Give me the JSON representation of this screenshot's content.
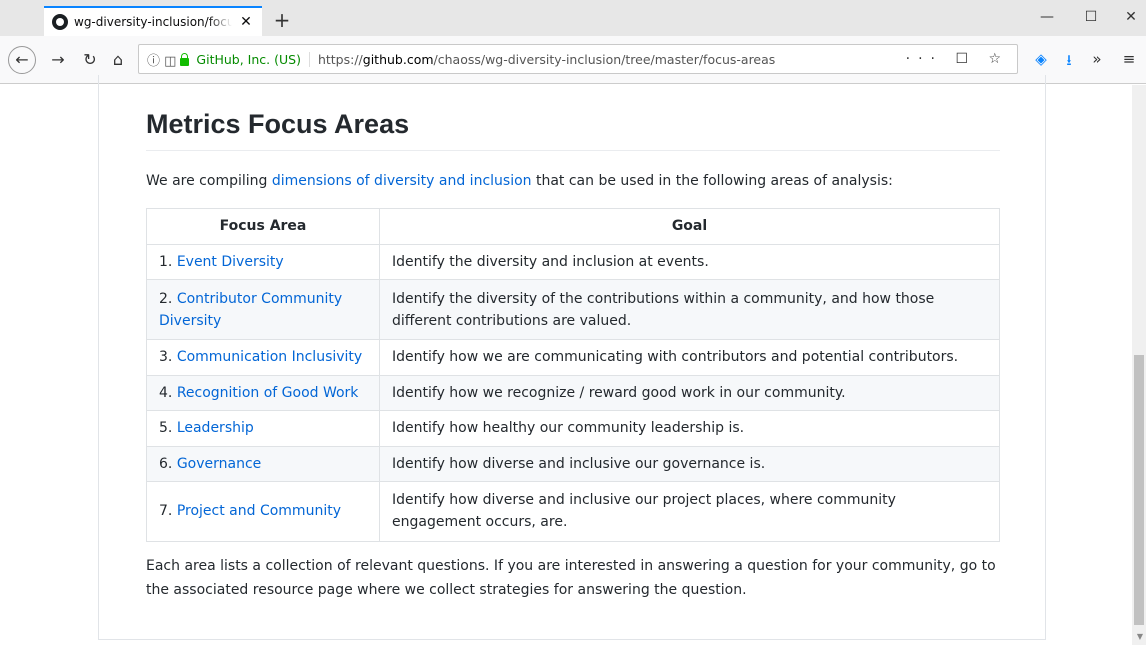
{
  "browser": {
    "tab_title": "wg-diversity-inclusion/focus-ar",
    "tab_close": "✕",
    "new_tab": "+",
    "identity": "GitHub, Inc. (US)",
    "url_prefix": "https://",
    "url_domain": "github.com",
    "url_path": "/chaoss/wg-diversity-inclusion/tree/master/focus-areas",
    "url_actions": "··· ☐ ☆"
  },
  "page": {
    "title": "Metrics Focus Areas",
    "intro_before": "We are compiling ",
    "intro_link": "dimensions of diversity and inclusion",
    "intro_after": " that can be used in the following areas of analysis:",
    "table": {
      "headers": [
        "Focus Area",
        "Goal"
      ],
      "rows": [
        {
          "num": "1. ",
          "area": "Event Diversity",
          "goal": "Identify the diversity and inclusion at events."
        },
        {
          "num": "2. ",
          "area": "Contributor Community Diversity",
          "goal": "Identify the diversity of the contributions within a community, and how those different contributions are valued."
        },
        {
          "num": "3. ",
          "area": "Communication Inclusivity",
          "goal": "Identify how we are communicating with contributors and potential contributors."
        },
        {
          "num": "4. ",
          "area": "Recognition of Good Work",
          "goal": "Identify how we recognize / reward good work in our community."
        },
        {
          "num": "5. ",
          "area": "Leadership",
          "goal": "Identify how healthy our community leadership is."
        },
        {
          "num": "6. ",
          "area": "Governance",
          "goal": "Identify how diverse and inclusive our governance is."
        },
        {
          "num": "7. ",
          "area": "Project and Community",
          "goal": "Identify how diverse and inclusive our project places, where community engagement occurs, are."
        }
      ]
    },
    "outro": "Each area lists a collection of relevant questions. If you are interested in answering a question for your community, go to the associated resource page where we collect strategies for answering the question."
  }
}
